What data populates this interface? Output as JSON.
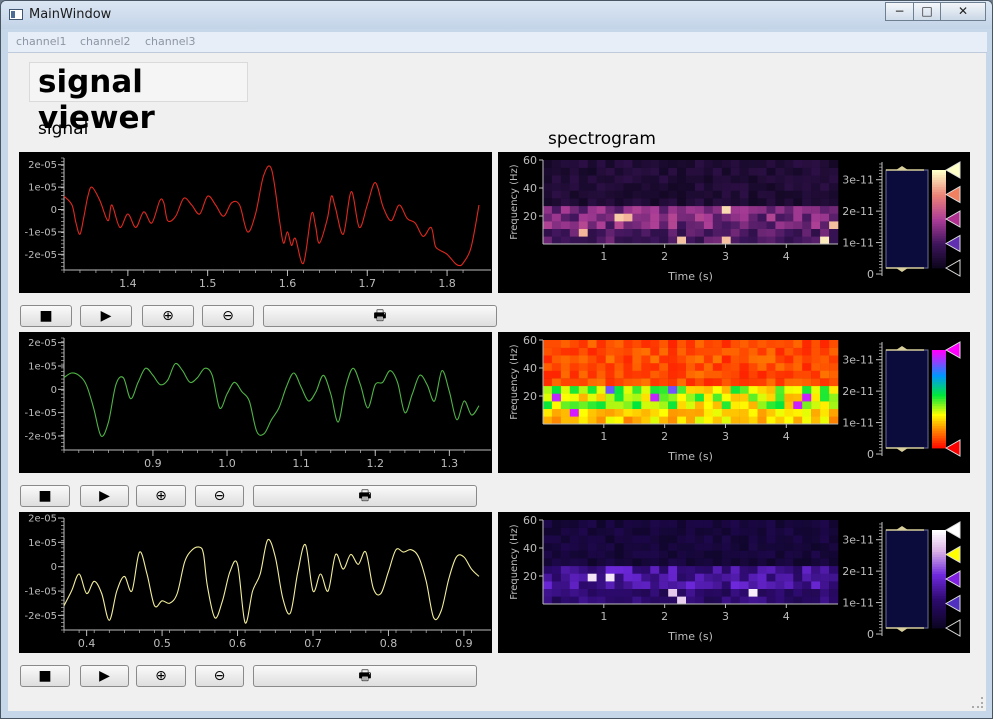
{
  "window": {
    "title": "MainWindow",
    "controls": {
      "minimize": "−",
      "maximize": "□",
      "close": "✕"
    }
  },
  "menu": [
    "channel1",
    "channel2",
    "channel3"
  ],
  "page": {
    "title": "signal viewer",
    "signal_label": "signal",
    "spectrogram_label": "spectrogram"
  },
  "buttons": [
    {
      "name": "stop",
      "icon": "stop-icon",
      "glyph": "■"
    },
    {
      "name": "play",
      "icon": "play-icon",
      "glyph": "▶"
    },
    {
      "name": "zoom-in",
      "icon": "zoom-in-icon",
      "glyph": "⊕"
    },
    {
      "name": "zoom-out",
      "icon": "zoom-out-icon",
      "glyph": "⊖"
    },
    {
      "name": "print",
      "icon": "printer-icon",
      "glyph": "🖶"
    }
  ],
  "colors": {
    "signal1": "#e0281e",
    "signal2": "#4fb445",
    "signal3": "#f2ee9a",
    "axis": "#bdbdbd"
  },
  "chart_data": [
    {
      "type": "line",
      "channel": "channel1",
      "color": "#e0281e",
      "xlim": [
        1.32,
        1.84
      ],
      "ylim": [
        -2.7e-05,
        2.3e-05
      ],
      "x_ticks": [
        "1.4",
        "1.5",
        "1.6",
        "1.7",
        "1.8"
      ],
      "x_tick_values": [
        1.4,
        1.5,
        1.6,
        1.7,
        1.8
      ],
      "y_ticks": [
        "2e-05",
        "1e-05",
        "0",
        "-1e-05",
        "-2e-05"
      ],
      "y_tick_values": [
        2e-05,
        1e-05,
        0,
        -1e-05,
        -2e-05
      ],
      "x": [
        1.32,
        1.33,
        1.335,
        1.34,
        1.345,
        1.35,
        1.355,
        1.365,
        1.375,
        1.38,
        1.39,
        1.4,
        1.41,
        1.42,
        1.43,
        1.44,
        1.445,
        1.45,
        1.46,
        1.47,
        1.48,
        1.49,
        1.5,
        1.51,
        1.52,
        1.53,
        1.54,
        1.55,
        1.56,
        1.57,
        1.58,
        1.59,
        1.595,
        1.6,
        1.605,
        1.61,
        1.62,
        1.63,
        1.635,
        1.64,
        1.65,
        1.655,
        1.66,
        1.67,
        1.68,
        1.69,
        1.7,
        1.71,
        1.72,
        1.73,
        1.74,
        1.75,
        1.76,
        1.77,
        1.78,
        1.785,
        1.79,
        1.8,
        1.81,
        1.815,
        1.82,
        1.83,
        1.84
      ],
      "y": [
        6e-06,
        2e-06,
        -6e-06,
        -1.1e-05,
        -3e-06,
        6e-06,
        1e-05,
        4e-06,
        -5e-06,
        2e-06,
        -8e-06,
        -2e-06,
        -8e-06,
        -1e-06,
        -6e-06,
        4e-06,
        3e-06,
        -5e-06,
        -3e-06,
        5e-06,
        2e-06,
        -2e-06,
        6e-06,
        2e-06,
        -3e-06,
        3e-06,
        2e-06,
        -1e-05,
        -2e-06,
        1.5e-05,
        1.8e-05,
        -5e-06,
        -1.5e-05,
        -1e-05,
        -1.6e-05,
        -1.3e-05,
        -2.4e-05,
        -2e-06,
        -7e-06,
        -1.5e-05,
        -4e-06,
        6e-06,
        1e-06,
        -1.1e-05,
        8e-06,
        -8e-06,
        2e-06,
        1.2e-05,
        1e-06,
        -5e-06,
        2e-06,
        -4e-06,
        -6e-06,
        -1.2e-05,
        -8e-06,
        -1.6e-05,
        -1.8e-05,
        -2e-05,
        -2.4e-05,
        -2.5e-05,
        -2.4e-05,
        -1.7e-05,
        2e-06
      ]
    },
    {
      "type": "line",
      "channel": "channel2",
      "color": "#4fb445",
      "xlim": [
        0.78,
        1.34
      ],
      "ylim": [
        -2.6e-05,
        2.2e-05
      ],
      "x_ticks": [
        "0.9",
        "1.0",
        "1.1",
        "1.2",
        "1.3"
      ],
      "x_tick_values": [
        0.9,
        1.0,
        1.1,
        1.2,
        1.3
      ],
      "y_ticks": [
        "2e-05",
        "1e-05",
        "0",
        "-1e-05",
        "-2e-05"
      ],
      "y_tick_values": [
        2e-05,
        1e-05,
        0,
        -1e-05,
        -2e-05
      ],
      "x": [
        0.78,
        0.79,
        0.8,
        0.81,
        0.82,
        0.83,
        0.84,
        0.85,
        0.86,
        0.87,
        0.88,
        0.89,
        0.9,
        0.91,
        0.92,
        0.93,
        0.94,
        0.95,
        0.96,
        0.97,
        0.98,
        0.99,
        1.0,
        1.01,
        1.02,
        1.03,
        1.04,
        1.05,
        1.06,
        1.07,
        1.08,
        1.09,
        1.1,
        1.11,
        1.12,
        1.13,
        1.14,
        1.15,
        1.16,
        1.17,
        1.18,
        1.19,
        1.2,
        1.21,
        1.22,
        1.23,
        1.24,
        1.25,
        1.26,
        1.27,
        1.28,
        1.29,
        1.3,
        1.31,
        1.32,
        1.33,
        1.34
      ],
      "y": [
        5e-06,
        7e-06,
        6e-06,
        2e-06,
        -8e-06,
        -2e-05,
        -1.4e-05,
        2e-06,
        5e-06,
        -4e-06,
        3e-06,
        9e-06,
        6e-06,
        2e-06,
        4e-06,
        1.1e-05,
        8e-06,
        3e-06,
        5e-06,
        9e-06,
        6e-06,
        -8e-06,
        -2e-06,
        3e-06,
        -1e-06,
        -5e-06,
        -1.8e-05,
        -1.9e-05,
        -1.3e-05,
        -8e-06,
        1e-06,
        7e-06,
        1e-06,
        -5e-06,
        -1e-06,
        6e-06,
        -2e-06,
        -1.4e-05,
        1e-06,
        9e-06,
        2e-06,
        -8e-06,
        2e-06,
        3e-06,
        8e-06,
        3e-06,
        -1e-05,
        -2e-06,
        6e-06,
        2e-06,
        -5e-06,
        8e-06,
        -1e-06,
        -1.3e-05,
        -5e-06,
        -1.1e-05,
        -7e-06
      ]
    },
    {
      "type": "line",
      "channel": "channel3",
      "color": "#f2ee9a",
      "xlim": [
        0.37,
        0.92
      ],
      "ylim": [
        -2.6e-05,
        2e-05
      ],
      "x_ticks": [
        "0.4",
        "0.5",
        "0.6",
        "0.7",
        "0.8",
        "0.9"
      ],
      "x_tick_values": [
        0.4,
        0.5,
        0.6,
        0.7,
        0.8,
        0.9
      ],
      "y_ticks": [
        "2e-05",
        "1e-05",
        "0",
        "-1e-05",
        "-2e-05"
      ],
      "y_tick_values": [
        2e-05,
        1e-05,
        0,
        -1e-05,
        -2e-05
      ],
      "x": [
        0.37,
        0.38,
        0.39,
        0.4,
        0.41,
        0.42,
        0.43,
        0.44,
        0.45,
        0.46,
        0.47,
        0.48,
        0.49,
        0.5,
        0.51,
        0.52,
        0.53,
        0.54,
        0.55,
        0.555,
        0.56,
        0.57,
        0.58,
        0.59,
        0.6,
        0.61,
        0.62,
        0.63,
        0.64,
        0.65,
        0.66,
        0.67,
        0.68,
        0.69,
        0.7,
        0.71,
        0.72,
        0.73,
        0.74,
        0.75,
        0.76,
        0.77,
        0.78,
        0.79,
        0.8,
        0.81,
        0.82,
        0.83,
        0.84,
        0.85,
        0.86,
        0.87,
        0.88,
        0.89,
        0.9,
        0.91,
        0.92
      ],
      "y": [
        -1.6e-05,
        -1e-05,
        -3e-06,
        -1.1e-05,
        -6e-06,
        -1.1e-05,
        -2.2e-05,
        -1e-05,
        -4e-06,
        -1e-05,
        6e-06,
        -3e-06,
        -1.6e-05,
        -1.4e-05,
        -1.5e-05,
        -1.1e-05,
        2e-06,
        7e-06,
        8e-06,
        5e-06,
        -8e-06,
        -2.1e-05,
        -1.4e-05,
        -2e-06,
        1e-06,
        -2.3e-05,
        -1e-05,
        -3e-06,
        1.1e-05,
        4e-06,
        -1.3e-05,
        -1.9e-05,
        -2e-06,
        9e-06,
        -1e-05,
        -3e-06,
        -1e-05,
        5e-06,
        -1e-06,
        5e-06,
        1e-06,
        6e-06,
        -9e-06,
        -1.1e-05,
        -2e-06,
        7e-06,
        6e-06,
        7e-06,
        4e-06,
        -6e-06,
        -2.1e-05,
        -1.8e-05,
        -5e-06,
        4e-06,
        4e-06,
        -1e-06,
        -4e-06
      ]
    },
    {
      "type": "heatmap",
      "channel": "channel1",
      "colormap": "hot-pink",
      "xlabel": "Time (s)",
      "ylabel": "Frequency (Hz)",
      "xlim": [
        0,
        4.85
      ],
      "ylim": [
        0,
        60
      ],
      "x_ticks": [
        "1",
        "2",
        "3",
        "4"
      ],
      "x_tick_values": [
        1,
        2,
        3,
        4
      ],
      "y_ticks": [
        "20",
        "40",
        "60"
      ],
      "y_tick_values": [
        20,
        40,
        60
      ],
      "colorbar_ticks": [
        "0",
        "1e-11",
        "2e-11",
        "3e-11"
      ],
      "colorbar_tick_values": [
        0,
        1e-11,
        2e-11,
        3e-11
      ],
      "colorbar_max": 3.5e-11,
      "colorbar_handles": [
        "#ffffc8",
        "#f08060",
        "#b03090",
        "#6030b0",
        "#000000"
      ]
    },
    {
      "type": "heatmap",
      "channel": "channel2",
      "colormap": "spectrum",
      "xlabel": "Time (s)",
      "ylabel": "Frequency (Hz)",
      "xlim": [
        0,
        4.85
      ],
      "ylim": [
        0,
        60
      ],
      "x_ticks": [
        "1",
        "2",
        "3",
        "4"
      ],
      "x_tick_values": [
        1,
        2,
        3,
        4
      ],
      "y_ticks": [
        "20",
        "40",
        "60"
      ],
      "y_tick_values": [
        20,
        40,
        60
      ],
      "colorbar_ticks": [
        "0",
        "1e-11",
        "2e-11",
        "3e-11"
      ],
      "colorbar_tick_values": [
        0,
        1e-11,
        2e-11,
        3e-11
      ],
      "colorbar_max": 3.5e-11,
      "colorbar_handles": [
        "#ff00ff",
        "#ff0000"
      ]
    },
    {
      "type": "heatmap",
      "channel": "channel3",
      "colormap": "yellow-blue",
      "xlabel": "Time (s)",
      "ylabel": "Frequency (Hz)",
      "xlim": [
        0,
        4.85
      ],
      "ylim": [
        0,
        60
      ],
      "x_ticks": [
        "1",
        "2",
        "3",
        "4"
      ],
      "x_tick_values": [
        1,
        2,
        3,
        4
      ],
      "y_ticks": [
        "20",
        "40",
        "60"
      ],
      "y_tick_values": [
        20,
        40,
        60
      ],
      "colorbar_ticks": [
        "0",
        "1e-11",
        "2e-11",
        "3e-11"
      ],
      "colorbar_tick_values": [
        0,
        1e-11,
        2e-11,
        3e-11
      ],
      "colorbar_max": 3.5e-11,
      "colorbar_handles": [
        "#ffffff",
        "#ffff00",
        "#8020e0",
        "#5030c0",
        "#000000"
      ]
    }
  ]
}
